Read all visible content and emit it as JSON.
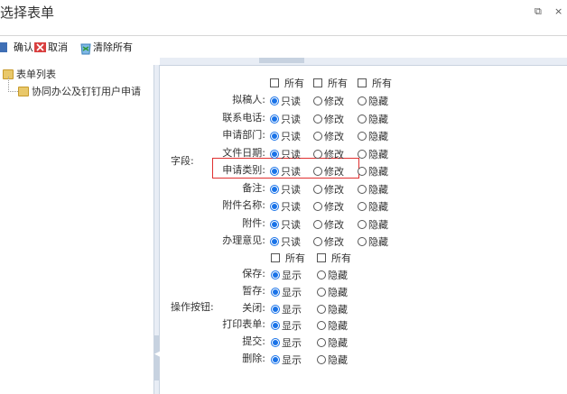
{
  "window": {
    "title": "选择表单"
  },
  "toolbar": {
    "confirm": "确认",
    "cancel": "取消",
    "clear_all": "清除所有"
  },
  "tree": {
    "root": "表单列表",
    "child": "协同办公及钉钉用户申请"
  },
  "fields_section": {
    "label": "字段:",
    "header": [
      "所有",
      "所有",
      "所有"
    ],
    "options": [
      "只读",
      "修改",
      "隐藏"
    ],
    "rows": [
      {
        "label": "拟稿人:",
        "selected": 0
      },
      {
        "label": "联系电话:",
        "selected": 0
      },
      {
        "label": "申请部门:",
        "selected": 0
      },
      {
        "label": "文件日期:",
        "selected": 0
      },
      {
        "label": "申请类别:",
        "selected": 0
      },
      {
        "label": "备注:",
        "selected": 0
      },
      {
        "label": "附件名称:",
        "selected": 0
      },
      {
        "label": "附件:",
        "selected": 0
      },
      {
        "label": "办理意见:",
        "selected": 0
      }
    ]
  },
  "buttons_section": {
    "label": "操作按钮:",
    "header": [
      "所有",
      "所有"
    ],
    "options": [
      "显示",
      "隐藏"
    ],
    "rows": [
      {
        "label": "保存:",
        "selected": 0
      },
      {
        "label": "暂存:",
        "selected": 0
      },
      {
        "label": "关闭:",
        "selected": 0
      },
      {
        "label": "打印表单:",
        "selected": 0
      },
      {
        "label": "提交:",
        "selected": 0
      },
      {
        "label": "删除:",
        "selected": 0
      }
    ]
  },
  "highlight_color": "#e03030",
  "accent_color": "#1a73e8"
}
